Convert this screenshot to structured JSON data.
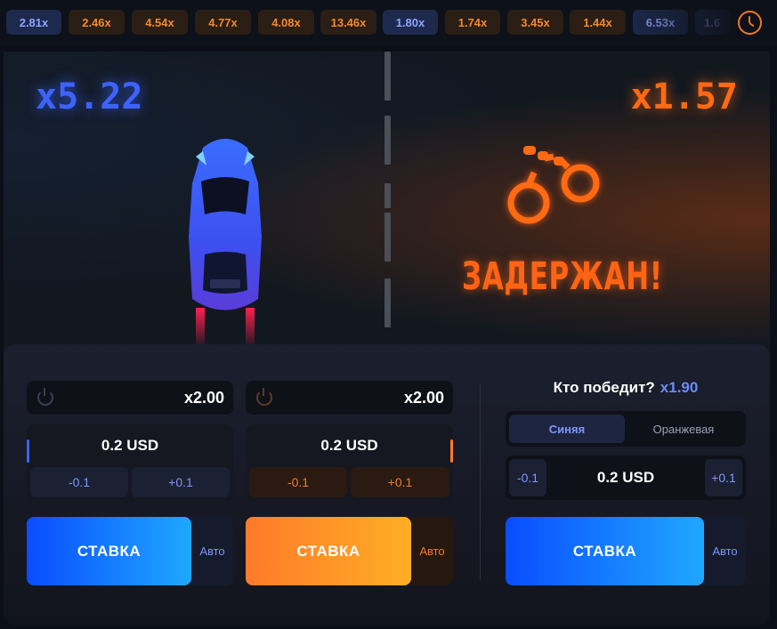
{
  "history": [
    {
      "value": "2.81x",
      "color": "blue"
    },
    {
      "value": "2.46x",
      "color": "orange"
    },
    {
      "value": "4.54x",
      "color": "orange"
    },
    {
      "value": "4.77x",
      "color": "orange"
    },
    {
      "value": "4.08x",
      "color": "orange"
    },
    {
      "value": "13.46x",
      "color": "orange"
    },
    {
      "value": "1.80x",
      "color": "blue"
    },
    {
      "value": "1.74x",
      "color": "orange"
    },
    {
      "value": "3.45x",
      "color": "orange"
    },
    {
      "value": "1.44x",
      "color": "orange"
    },
    {
      "value": "6.53x",
      "color": "blue"
    },
    {
      "value": "1.6",
      "color": "blue"
    }
  ],
  "game": {
    "blue_multiplier": "x5.22",
    "orange_multiplier": "x1.57",
    "status": "ЗАДЕРЖАН!"
  },
  "left_panel": {
    "auto_multiplier": "x2.00",
    "amount": "0.2 USD",
    "minus": "-0.1",
    "plus": "+0.1",
    "stake_label": "СТАВКА",
    "auto_label": "Авто"
  },
  "middle_panel": {
    "auto_multiplier": "x2.00",
    "amount": "0.2 USD",
    "minus": "-0.1",
    "plus": "+0.1",
    "stake_label": "СТАВКА",
    "auto_label": "Авто"
  },
  "right_panel": {
    "question": "Кто победит?",
    "odds": "x1.90",
    "team_blue": "Синяя",
    "team_orange": "Оранжевая",
    "selected_team": "Синяя",
    "minus": "-0.1",
    "plus": "+0.1",
    "amount": "0.2 USD",
    "stake_label": "СТАВКА",
    "auto_label": "Авто"
  },
  "colors": {
    "blue_accent": "#3d63ff",
    "orange_accent": "#ff6a12"
  }
}
